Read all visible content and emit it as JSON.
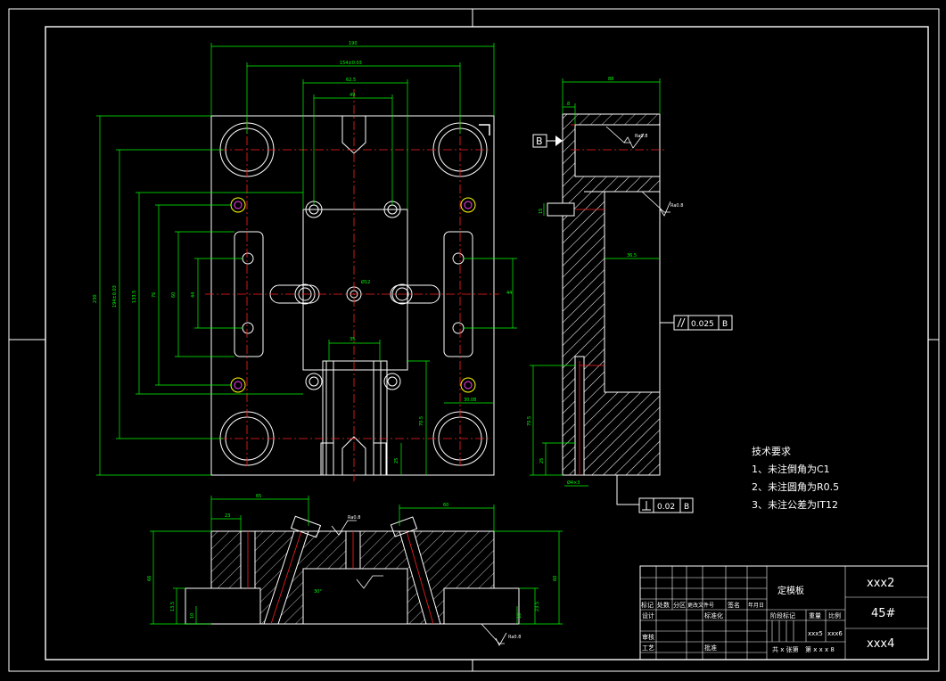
{
  "title_block": {
    "part_name": "定模板",
    "drawing_no": "xxx2",
    "material": "45#",
    "company": "xxx4",
    "weight": "xxx5",
    "scale": "xxx6",
    "sheets": "共 x 张第",
    "sheet_of": "第 x x x 8",
    "row_headers": [
      "标记",
      "处数",
      "分区",
      "更改文件号",
      "签名",
      "年月日"
    ],
    "role_design": "设计",
    "role_standard": "标准化",
    "role_check": "审核",
    "role_process": "工艺",
    "role_approve": "批准",
    "stage_label": "阶段标记",
    "weight_label": "重量",
    "scale_label": "比例"
  },
  "technical_requirements": {
    "heading": "技术要求",
    "items": [
      "1、未注倒角为C1",
      "2、未注圆角为R0.5",
      "3、未注公差为IT12"
    ]
  },
  "dimensions": {
    "top_total_width": "190",
    "top_hole_span": "154±0.03",
    "top_inner_span": "62.5",
    "top_slot_width": "49",
    "left_total_height": "230",
    "left_hole_span": "194±0.03",
    "left_dim_3": "133.5",
    "left_dim_4": "76",
    "left_dim_5": "60",
    "left_dim_6": "44",
    "right_dim": "44",
    "inner_width": "35",
    "slot_r": "30.08",
    "center_hole": "Ø12",
    "height_705": "70.5",
    "height_25": "25",
    "side_width": "88",
    "side_small": "8",
    "side_depth": "36.5",
    "side_height": "70.5",
    "side_small2": "25",
    "side_bottom": "Ø4×3",
    "side_small_left": "15",
    "bottom_left_width": "65",
    "bottom_left_small": "23",
    "bottom_right_width": "60",
    "bottom_height": "66",
    "bottom_right_height": "60",
    "bottom_small_l": "13.5",
    "bottom_small_l2": "10",
    "bottom_small_r": "23.5",
    "bottom_small_r2": "10",
    "angle_label": "30°"
  },
  "annotations": {
    "datum_letter": "B",
    "parallel_tol": "0.025",
    "parallel_datum": "B",
    "perp_tol": "0.02",
    "perp_datum": "B",
    "roughness_1": "Ra0.8",
    "roughness_2": "Ra0.8",
    "roughness_3": "Ra0.8",
    "roughness_4": "Ra0.8"
  },
  "colors": {
    "background": "#000000",
    "outline": "#ffffff",
    "dimension": "#00ff00",
    "centerline": "#ff2020",
    "hole": "#ffff00",
    "hatch": "#ffffff"
  }
}
